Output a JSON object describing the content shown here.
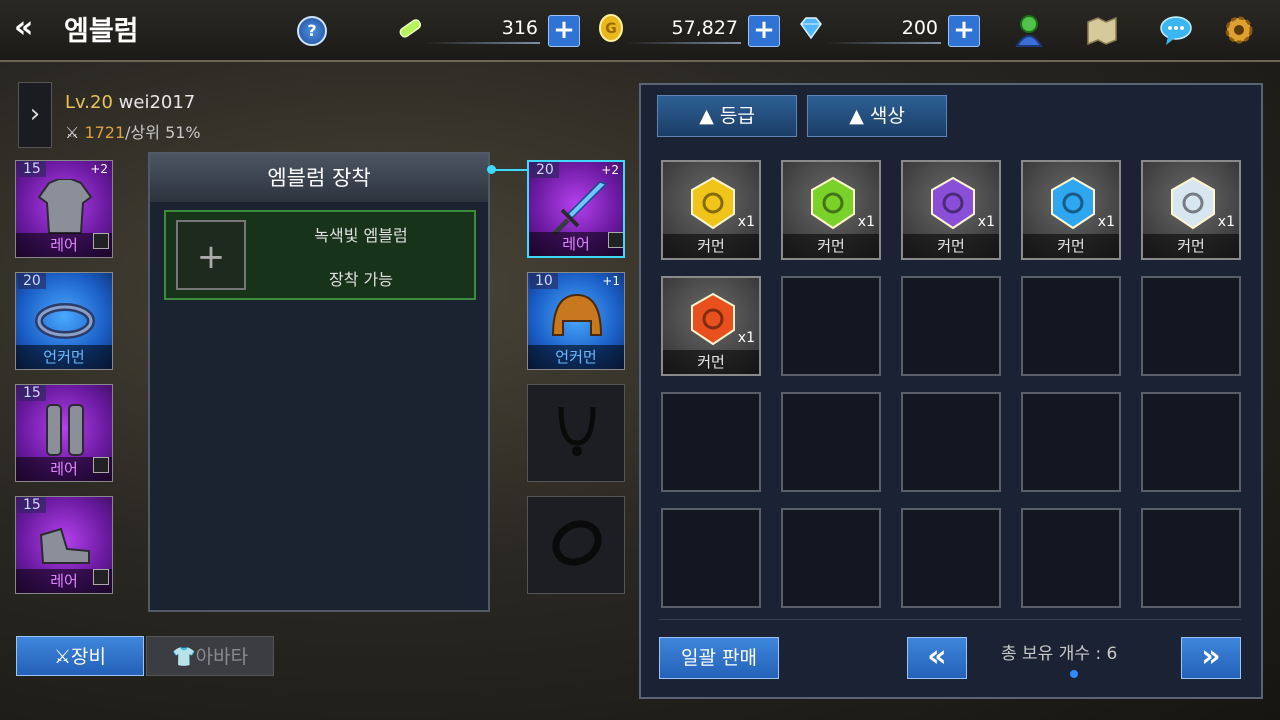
{
  "header": {
    "title": "엠블럼",
    "stamina": "316",
    "gold": "57,827",
    "gems": "200",
    "plus": "+",
    "help": "?"
  },
  "player": {
    "level": "Lv.20",
    "name": "wei2017",
    "power": "1721",
    "rank": "/상위 51%"
  },
  "left_slots": [
    {
      "level": "15",
      "plus": "+2",
      "grade": "레어"
    },
    {
      "level": "20",
      "plus": "",
      "grade": "언커먼"
    },
    {
      "level": "15",
      "plus": "",
      "grade": "레어"
    },
    {
      "level": "15",
      "plus": "",
      "grade": "레어"
    }
  ],
  "emblem_panel": {
    "title": "엠블럼 장착",
    "slot_plus": "+",
    "slot_name": "녹색빛 엠블럼",
    "slot_status": "장착 가능"
  },
  "right_slots": [
    {
      "level": "20",
      "plus": "+2",
      "grade": "레어"
    },
    {
      "level": "10",
      "plus": "+1",
      "grade": "언커먼"
    }
  ],
  "tabs": {
    "equip": "장비",
    "avatar": "아바타"
  },
  "inventory": {
    "sort_grade": "▲ 등급",
    "sort_color": "▲ 색상",
    "items": [
      {
        "qty": "x1",
        "grade": "커먼",
        "color": "#f0c419",
        "icon": "gold-emblem-icon"
      },
      {
        "qty": "x1",
        "grade": "커먼",
        "color": "#7ad12a",
        "icon": "green-emblem-icon"
      },
      {
        "qty": "x1",
        "grade": "커먼",
        "color": "#8a4fd8",
        "icon": "purple-emblem-icon"
      },
      {
        "qty": "x1",
        "grade": "커먼",
        "color": "#2ea6f0",
        "icon": "blue-emblem-icon"
      },
      {
        "qty": "x1",
        "grade": "커먼",
        "color": "#d8e6f0",
        "icon": "white-emblem-icon"
      },
      {
        "qty": "x1",
        "grade": "커먼",
        "color": "#e8501e",
        "icon": "red-emblem-icon"
      }
    ],
    "sell_all": "일괄 판매",
    "prev": "«",
    "next": "»",
    "count_text": "총 보유 개수 : 6"
  }
}
